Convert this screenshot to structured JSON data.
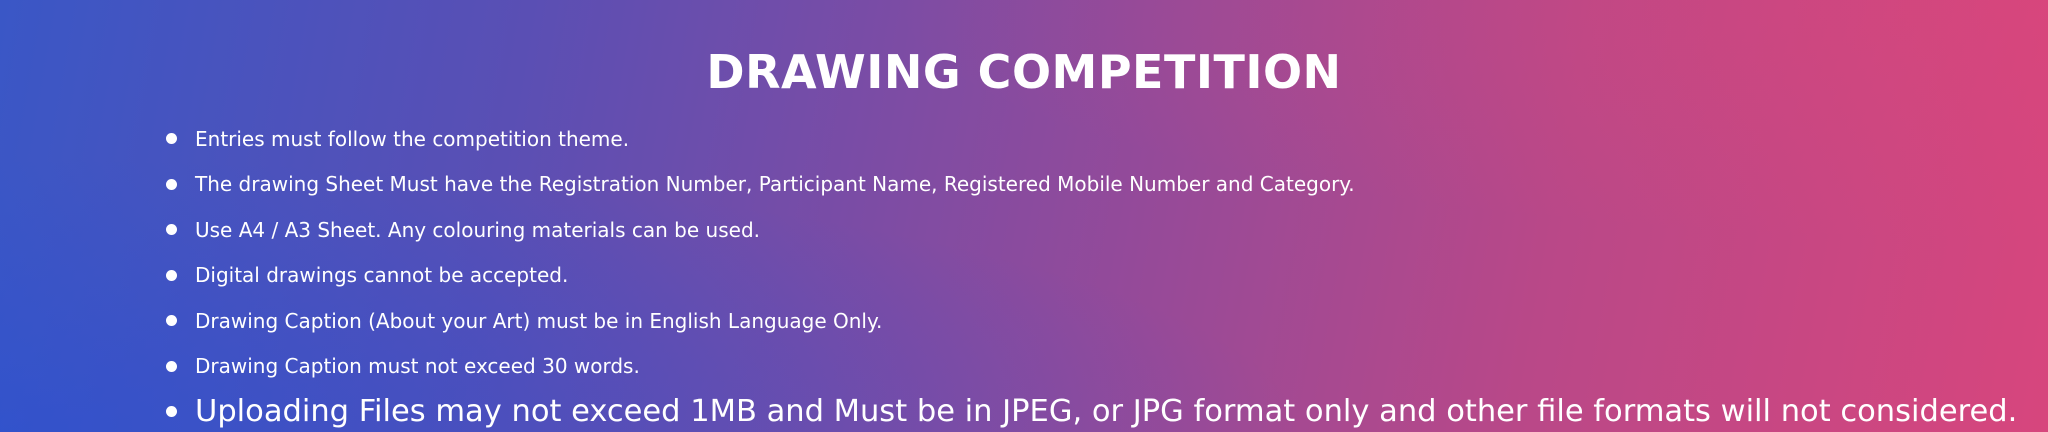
{
  "title": "DRAWING COMPETITION",
  "rules": [
    "Entries must follow the competition theme.",
    "The drawing Sheet Must have the Registration Number, Participant Name, Registered Mobile Number and Category.",
    "Use A4 / A3 Sheet. Any colouring materials can be used.",
    "Digital drawings cannot be accepted.",
    "Drawing Caption (About your Art) must be in English Language Only.",
    "Drawing Caption must not exceed 30 words.",
    "Uploading Files may not exceed 1MB and Must be in JPEG, or JPG format only and other file formats will not considered."
  ],
  "colors": {
    "gradient_left": "#3a57c6",
    "gradient_middle": "#8a4b9e",
    "gradient_right": "#d7467d",
    "text": "#ffffff"
  }
}
